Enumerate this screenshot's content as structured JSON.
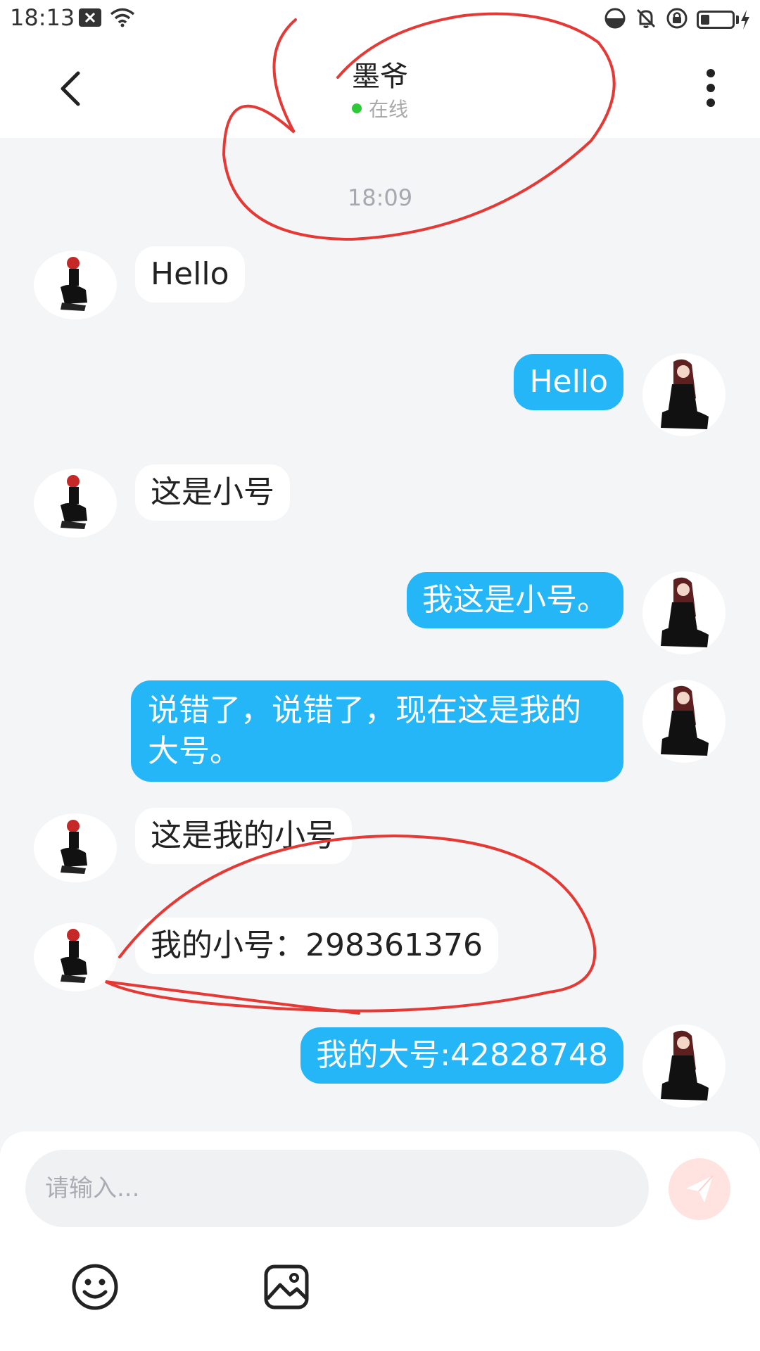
{
  "status_bar": {
    "time": "18:13",
    "icons": [
      "notification-close-icon",
      "wifi-icon",
      "data-saver-icon",
      "bell-off-icon",
      "lock-rotation-icon",
      "battery-charging-icon"
    ]
  },
  "header": {
    "contact_name": "墨爷",
    "status_text": "在线",
    "status_color": "#2dc937",
    "back_icon": "back-arrow-icon",
    "more_icon": "more-vertical-icon"
  },
  "chat": {
    "time_divider": "18:09",
    "messages": [
      {
        "side": "incoming",
        "text": "Hello"
      },
      {
        "side": "outgoing",
        "text": "Hello"
      },
      {
        "side": "incoming",
        "text": "这是小号"
      },
      {
        "side": "outgoing",
        "text": "我这是小号。"
      },
      {
        "side": "outgoing",
        "text": "说错了，说错了，现在这是我的大号。"
      },
      {
        "side": "incoming",
        "text": "这是我的小号"
      },
      {
        "side": "incoming",
        "text": "我的小号：298361376"
      },
      {
        "side": "outgoing",
        "text": "我的大号:42828748"
      }
    ]
  },
  "composer": {
    "placeholder": "请输入...",
    "send_icon": "send-icon",
    "emoji_icon": "emoji-icon",
    "image_icon": "image-icon"
  },
  "colors": {
    "outgoing_bubble": "#25b6f7",
    "incoming_bubble": "#ffffff",
    "background": "#f4f5f7",
    "annotation_ink": "#e53935",
    "send_button": "#ffe3e0"
  }
}
